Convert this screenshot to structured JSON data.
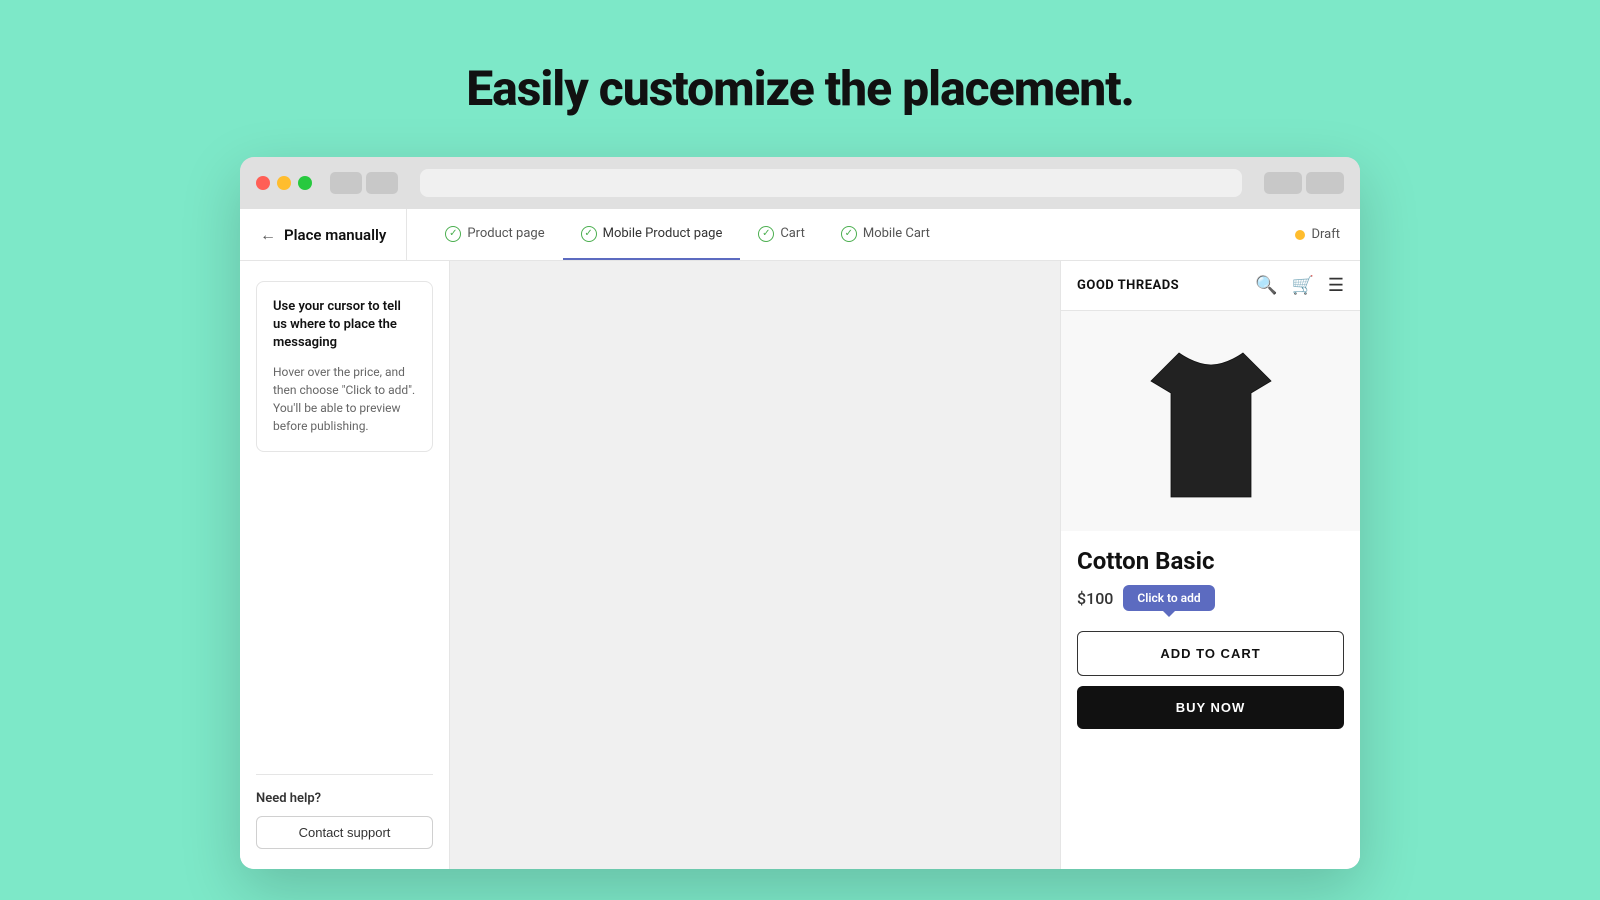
{
  "hero": {
    "heading": "Easily customize the placement."
  },
  "browser": {
    "address_bar_placeholder": ""
  },
  "app_nav": {
    "back_label": "Place manually",
    "tabs": [
      {
        "id": "product-page",
        "label": "Product page",
        "active": false,
        "done": true
      },
      {
        "id": "mobile-product-page",
        "label": "Mobile Product page",
        "active": true,
        "done": true
      },
      {
        "id": "cart",
        "label": "Cart",
        "active": false,
        "done": true
      },
      {
        "id": "mobile-cart",
        "label": "Mobile Cart",
        "active": false,
        "done": true
      }
    ],
    "draft_label": "Draft"
  },
  "sidebar": {
    "instruction_title": "Use your cursor to tell us where to place the messaging",
    "instruction_body": "Hover over the price, and then choose \"Click to add\". You'll be able to preview before publishing.",
    "need_help_label": "Need help?",
    "contact_support_label": "Contact support"
  },
  "product": {
    "store_name": "GOOD THREADS",
    "name": "Cotton Basic",
    "price": "$100",
    "click_to_add_label": "Click to add",
    "add_to_cart_label": "ADD TO CART",
    "buy_now_label": "BUY NOW"
  }
}
